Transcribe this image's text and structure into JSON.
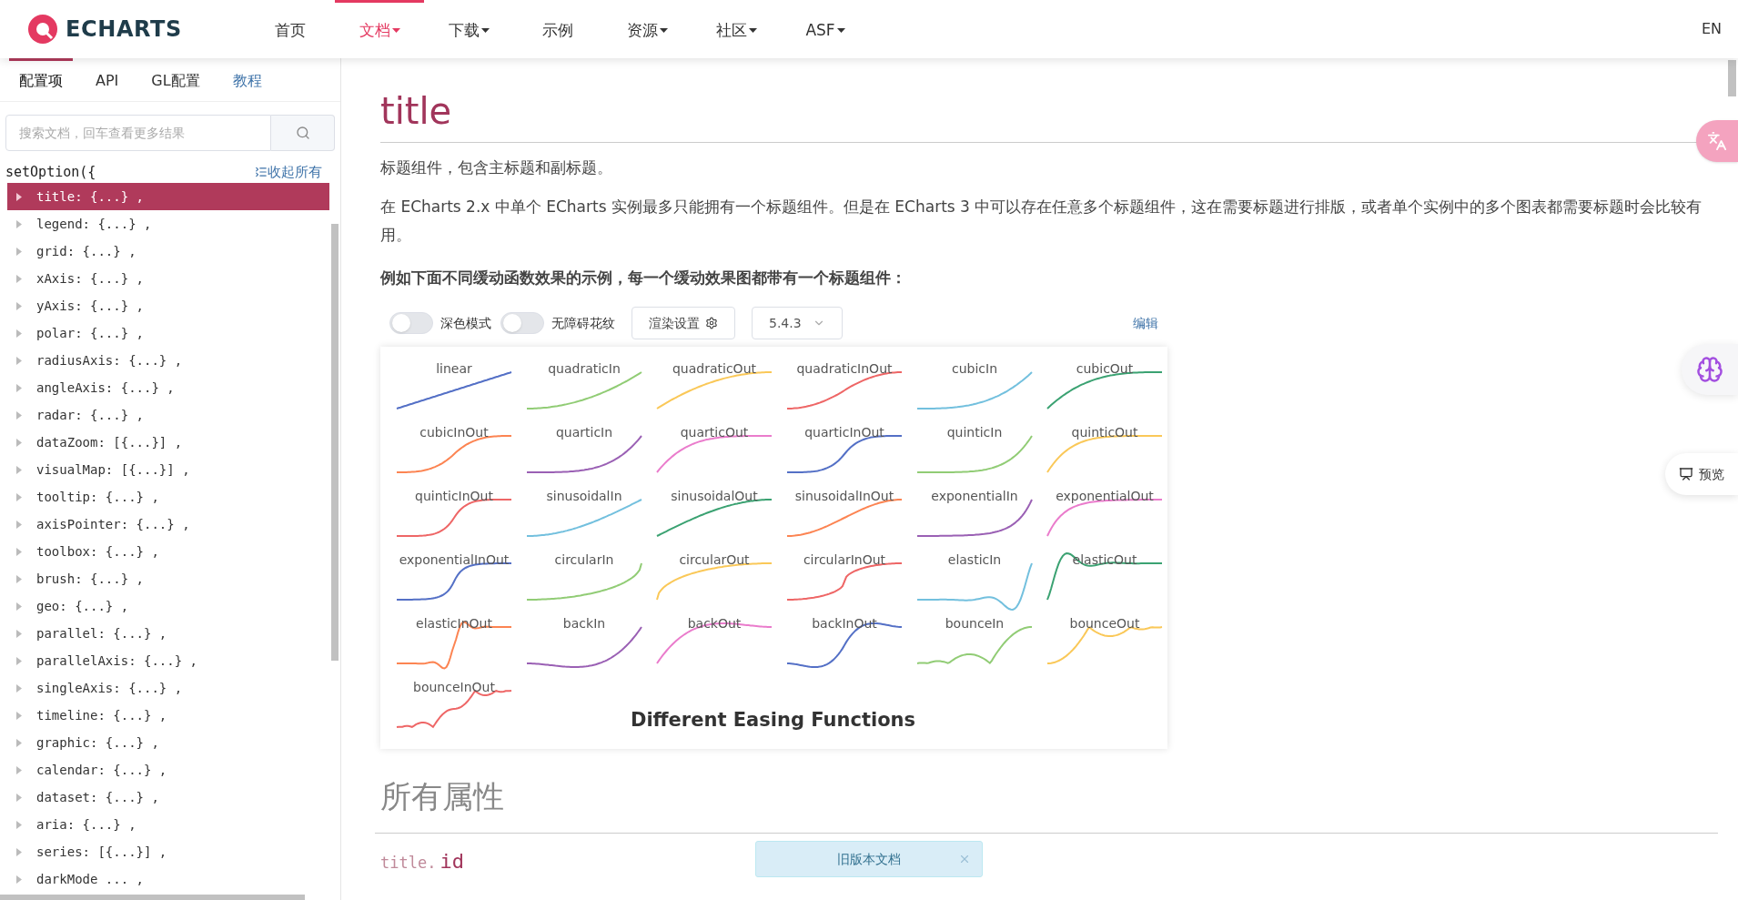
{
  "header": {
    "logo": "ECHARTS",
    "nav": [
      {
        "label": "首页",
        "dropdown": false,
        "selected": false
      },
      {
        "label": "文档",
        "dropdown": true,
        "selected": true
      },
      {
        "label": "下载",
        "dropdown": true,
        "selected": false
      },
      {
        "label": "示例",
        "dropdown": false,
        "selected": false
      },
      {
        "label": "资源",
        "dropdown": true,
        "selected": false
      },
      {
        "label": "社区",
        "dropdown": true,
        "selected": false
      },
      {
        "label": "ASF",
        "dropdown": true,
        "selected": false
      }
    ],
    "language": "EN"
  },
  "sidebar": {
    "tabs": [
      {
        "label": "配置项",
        "kind": "tab",
        "selected": true
      },
      {
        "label": "API",
        "kind": "tab",
        "selected": false
      },
      {
        "label": "GL配置",
        "kind": "tab",
        "selected": false
      },
      {
        "label": "教程",
        "kind": "link",
        "selected": false
      }
    ],
    "search": {
      "placeholder": "搜索文档，回车查看更多结果"
    },
    "root": "setOption({",
    "collapse_all": "收起所有",
    "items": [
      {
        "text": "title: {...} ,",
        "selected": true
      },
      {
        "text": "legend: {...} ,",
        "selected": false
      },
      {
        "text": "grid: {...} ,",
        "selected": false
      },
      {
        "text": "xAxis: {...} ,",
        "selected": false
      },
      {
        "text": "yAxis: {...} ,",
        "selected": false
      },
      {
        "text": "polar: {...} ,",
        "selected": false
      },
      {
        "text": "radiusAxis: {...} ,",
        "selected": false
      },
      {
        "text": "angleAxis: {...} ,",
        "selected": false
      },
      {
        "text": "radar: {...} ,",
        "selected": false
      },
      {
        "text": "dataZoom: [{...}] ,",
        "selected": false
      },
      {
        "text": "visualMap: [{...}] ,",
        "selected": false
      },
      {
        "text": "tooltip: {...} ,",
        "selected": false
      },
      {
        "text": "axisPointer: {...} ,",
        "selected": false
      },
      {
        "text": "toolbox: {...} ,",
        "selected": false
      },
      {
        "text": "brush: {...} ,",
        "selected": false
      },
      {
        "text": "geo: {...} ,",
        "selected": false
      },
      {
        "text": "parallel: {...} ,",
        "selected": false
      },
      {
        "text": "parallelAxis: {...} ,",
        "selected": false
      },
      {
        "text": "singleAxis: {...} ,",
        "selected": false
      },
      {
        "text": "timeline: {...} ,",
        "selected": false
      },
      {
        "text": "graphic: {...} ,",
        "selected": false
      },
      {
        "text": "calendar: {...} ,",
        "selected": false
      },
      {
        "text": "dataset: {...} ,",
        "selected": false
      },
      {
        "text": "aria: {...} ,",
        "selected": false
      },
      {
        "text": "series: [{...}] ,",
        "selected": false
      },
      {
        "text": "darkMode ... ,",
        "selected": false
      }
    ]
  },
  "content": {
    "heading": "title",
    "paragraphs": [
      {
        "text": "标题组件，包含主标题和副标题。",
        "bold": false
      },
      {
        "text": "在 ECharts 2.x 中单个 ECharts 实例最多只能拥有一个标题组件。但是在 ECharts 3 中可以存在任意多个标题组件，这在需要标题进行排版，或者单个实例中的多个图表都需要标题时会比较有用。",
        "bold": false
      },
      {
        "text": "例如下面不同缓动函数效果的示例，每一个缓动效果图都带有一个标题组件：",
        "bold": true
      }
    ],
    "example": {
      "toggles": [
        {
          "label": "深色模式",
          "on": false
        },
        {
          "label": "无障碍花纹",
          "on": false
        }
      ],
      "render_settings": "渲染设置",
      "version": "5.4.3",
      "edit": "编辑",
      "chart_title": "Different Easing Functions",
      "curves": [
        {
          "label": "linear",
          "color": "#5470c6"
        },
        {
          "label": "quadraticIn",
          "color": "#91cc75"
        },
        {
          "label": "quadraticOut",
          "color": "#fac858"
        },
        {
          "label": "quadraticInOut",
          "color": "#ee6666"
        },
        {
          "label": "cubicIn",
          "color": "#73c0de"
        },
        {
          "label": "cubicOut",
          "color": "#3ba272"
        },
        {
          "label": "cubicInOut",
          "color": "#fc8452"
        },
        {
          "label": "quarticIn",
          "color": "#9a60b4"
        },
        {
          "label": "quarticOut",
          "color": "#ea7ccc"
        },
        {
          "label": "quarticInOut",
          "color": "#5470c6"
        },
        {
          "label": "quinticIn",
          "color": "#91cc75"
        },
        {
          "label": "quinticOut",
          "color": "#fac858"
        },
        {
          "label": "quinticInOut",
          "color": "#ee6666"
        },
        {
          "label": "sinusoidalIn",
          "color": "#73c0de"
        },
        {
          "label": "sinusoidalOut",
          "color": "#3ba272"
        },
        {
          "label": "sinusoidalInOut",
          "color": "#fc8452"
        },
        {
          "label": "exponentialIn",
          "color": "#9a60b4"
        },
        {
          "label": "exponentialOut",
          "color": "#ea7ccc"
        },
        {
          "label": "exponentialInOut",
          "color": "#5470c6"
        },
        {
          "label": "circularIn",
          "color": "#91cc75"
        },
        {
          "label": "circularOut",
          "color": "#fac858"
        },
        {
          "label": "circularInOut",
          "color": "#ee6666"
        },
        {
          "label": "elasticIn",
          "color": "#73c0de"
        },
        {
          "label": "elasticOut",
          "color": "#3ba272"
        },
        {
          "label": "elasticInOut",
          "color": "#fc8452"
        },
        {
          "label": "backIn",
          "color": "#9a60b4"
        },
        {
          "label": "backOut",
          "color": "#ea7ccc"
        },
        {
          "label": "backInOut",
          "color": "#5470c6"
        },
        {
          "label": "bounceIn",
          "color": "#91cc75"
        },
        {
          "label": "bounceOut",
          "color": "#fac858"
        },
        {
          "label": "bounceInOut",
          "color": "#ee6666"
        }
      ]
    },
    "section_heading": "所有属性",
    "property": {
      "prefix": "title.",
      "name": "id"
    }
  },
  "floating": {
    "preview": "预览"
  },
  "toast": {
    "text": "旧版本文档"
  }
}
